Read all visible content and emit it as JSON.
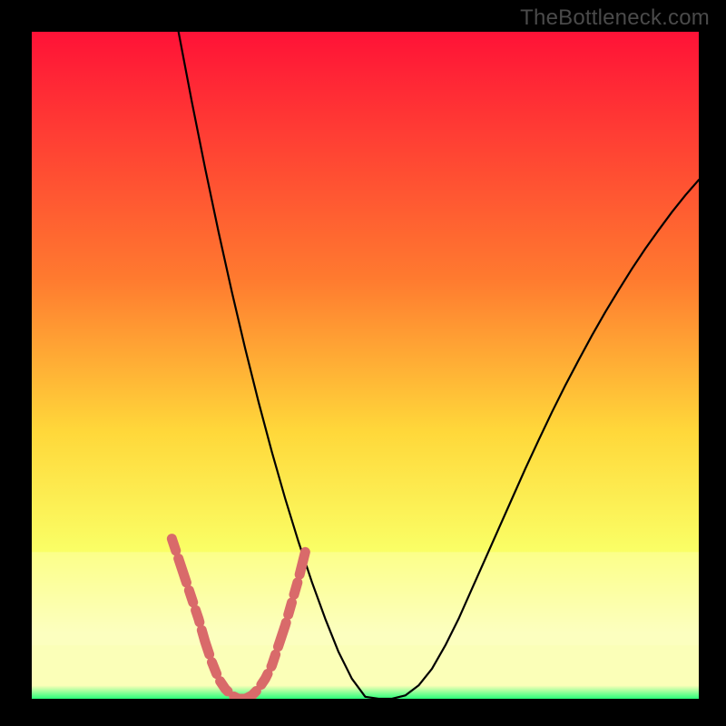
{
  "watermark": "TheBottleneck.com",
  "colors": {
    "grad_top": "#ff1237",
    "grad_mid1": "#ff7a2f",
    "grad_mid2": "#ffd83a",
    "grad_mid3": "#faff66",
    "grad_mid4": "#fbffb8",
    "grad_bot": "#2aff7a",
    "curve": "#000000",
    "dotted": "#d96a6a",
    "black_frame": "#000000"
  },
  "chart_data": {
    "type": "line",
    "title": "",
    "xlabel": "",
    "ylabel": "",
    "xlim": [
      0,
      100
    ],
    "ylim": [
      0,
      100
    ],
    "x": [
      0,
      2,
      4,
      6,
      8,
      10,
      12,
      14,
      16,
      18,
      20,
      22,
      24,
      26,
      28,
      30,
      32,
      34,
      36,
      38,
      40,
      42,
      44,
      46,
      48,
      50,
      52,
      54,
      56,
      58,
      60,
      62,
      64,
      66,
      68,
      70,
      72,
      74,
      76,
      78,
      80,
      82,
      84,
      86,
      88,
      90,
      92,
      94,
      96,
      98,
      100
    ],
    "series": [
      {
        "name": "curve",
        "values": [
          null,
          null,
          null,
          null,
          null,
          null,
          null,
          null,
          null,
          null,
          null,
          100.0,
          89.5,
          79.5,
          70.0,
          61.0,
          52.5,
          44.5,
          37.0,
          30.0,
          23.5,
          17.5,
          12.0,
          7.0,
          3.0,
          0.3,
          0.0,
          0.0,
          0.5,
          2.0,
          4.5,
          8.0,
          12.0,
          16.5,
          21.0,
          25.5,
          30.0,
          34.5,
          38.8,
          43.0,
          47.0,
          50.8,
          54.5,
          58.0,
          61.3,
          64.5,
          67.5,
          70.3,
          73.0,
          75.5,
          77.8
        ]
      }
    ],
    "dotted_overlay": {
      "name": "highlight_zone",
      "x": [
        20,
        21,
        22,
        23,
        24,
        25,
        26,
        27,
        28,
        29,
        30,
        31,
        32,
        33,
        34,
        35,
        36,
        37,
        38,
        39,
        40
      ],
      "values": [
        24.0,
        21.0,
        18.0,
        15.0,
        12.0,
        8.5,
        5.5,
        3.0,
        1.5,
        0.5,
        0.0,
        0.0,
        0.5,
        1.5,
        3.0,
        5.0,
        8.0,
        11.0,
        14.5,
        18.0,
        22.0
      ]
    }
  }
}
